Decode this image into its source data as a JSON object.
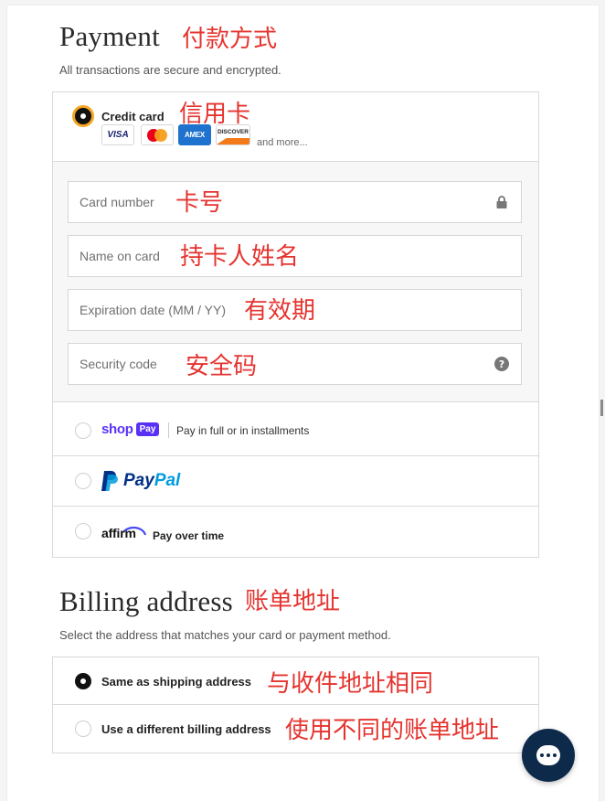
{
  "payment": {
    "title": "Payment",
    "title_annotation": "付款方式",
    "subtitle": "All transactions are secure and encrypted."
  },
  "credit_card": {
    "label": "Credit card",
    "annotation": "信用卡",
    "logos": [
      "VISA",
      "AMEX",
      "DISCOVER"
    ],
    "and_more": "and more...",
    "fields": {
      "card_number": {
        "placeholder": "Card number",
        "annotation": "卡号"
      },
      "name_on_card": {
        "placeholder": "Name on card",
        "annotation": "持卡人姓名"
      },
      "expiration": {
        "placeholder": "Expiration date (MM / YY)",
        "annotation": "有效期"
      },
      "security_code": {
        "placeholder": "Security code",
        "annotation": "安全码"
      }
    }
  },
  "alt_methods": {
    "shop_pay": {
      "brand": "shop",
      "badge": "Pay",
      "label": "Pay in full or in installments"
    },
    "paypal": {
      "brand_pay": "Pay",
      "brand_pal": "Pal"
    },
    "affirm": {
      "brand": "affirm",
      "label": "Pay over time"
    }
  },
  "billing": {
    "title": "Billing address",
    "title_annotation": "账单地址",
    "subtitle": "Select the address that matches your card or payment method.",
    "options": [
      {
        "label": "Same as shipping address",
        "annotation": "与收件地址相同"
      },
      {
        "label": "Use a different billing address",
        "annotation": "使用不同的账单地址"
      }
    ]
  },
  "colors": {
    "annotation_red": "#e5342f",
    "focus_orange": "#f5a623",
    "shop_pay_purple": "#5a31f4",
    "paypal_dark_blue": "#003087",
    "paypal_light_blue": "#009cde",
    "chat_navy": "#0e2a4a"
  },
  "icons": {
    "card_number": "lock-icon",
    "security_code": "help-circle-icon",
    "chat": "chat-bubble-icon"
  }
}
